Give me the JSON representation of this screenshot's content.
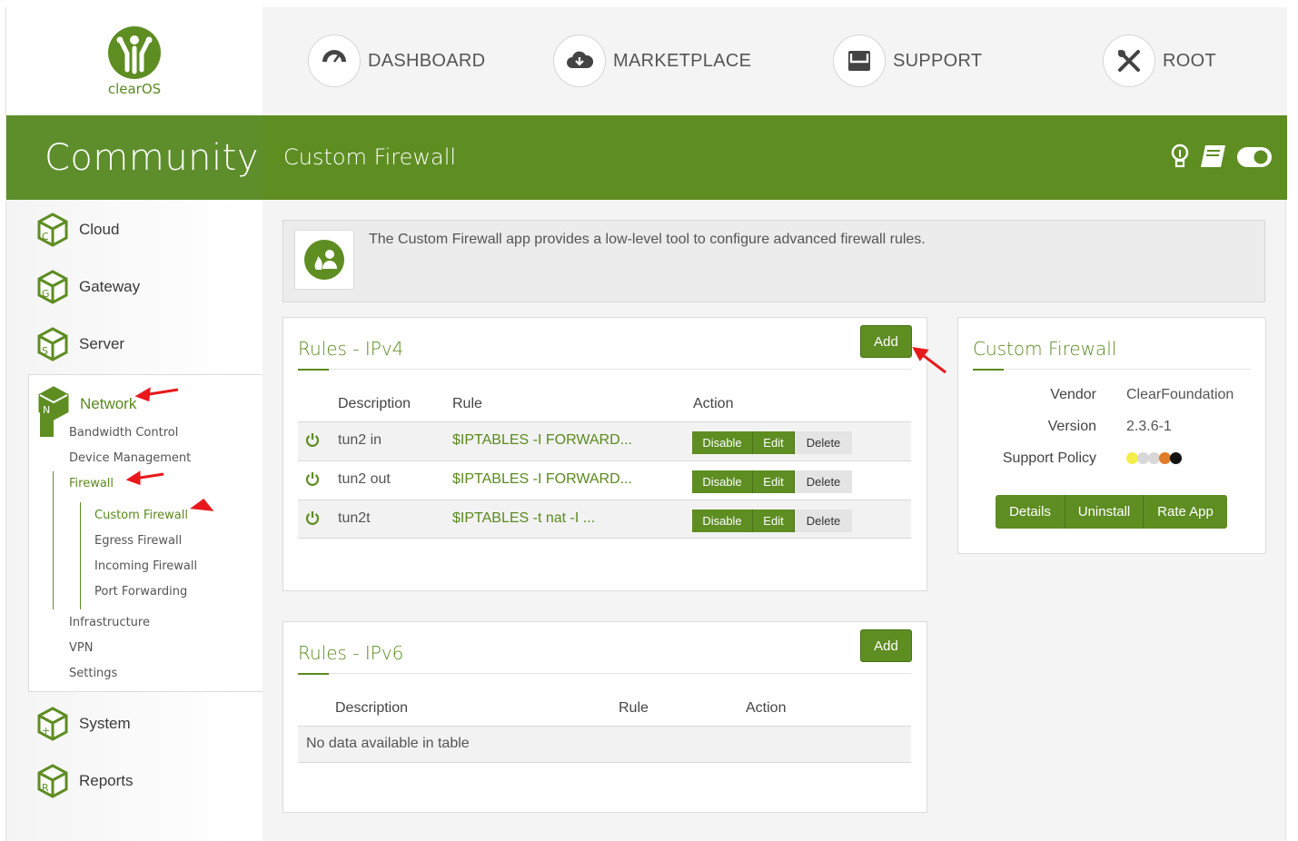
{
  "logo": {
    "text": "clearOS"
  },
  "topnav": [
    {
      "label": "DASHBOARD",
      "icon": "speedometer-icon"
    },
    {
      "label": "MARKETPLACE",
      "icon": "cloud-download-icon"
    },
    {
      "label": "SUPPORT",
      "icon": "inbox-icon"
    },
    {
      "label": "ROOT",
      "icon": "tools-icon"
    }
  ],
  "edition": "Community",
  "app_title": "Custom Firewall",
  "sidebar": {
    "items": [
      {
        "label": "Cloud",
        "letter": "C"
      },
      {
        "label": "Gateway",
        "letter": "G"
      },
      {
        "label": "Server",
        "letter": "S"
      },
      {
        "label": "Network",
        "letter": "N"
      },
      {
        "label": "System",
        "letter": "+"
      },
      {
        "label": "Reports",
        "letter": "R"
      }
    ],
    "network_sub": [
      "Bandwidth Control",
      "Device Management",
      "Firewall",
      "Infrastructure",
      "VPN",
      "Settings"
    ],
    "firewall_sub": [
      "Custom Firewall",
      "Egress Firewall",
      "Incoming Firewall",
      "Port Forwarding"
    ]
  },
  "intro": {
    "text": "The Custom Firewall app provides a low-level tool to configure advanced firewall rules."
  },
  "ipv4": {
    "title": "Rules - IPv4",
    "add_label": "Add",
    "columns": {
      "description": "Description",
      "rule": "Rule",
      "action": "Action"
    },
    "rows": [
      {
        "description": "tun2 in",
        "rule": "$IPTABLES -I FORWARD..."
      },
      {
        "description": "tun2 out",
        "rule": "$IPTABLES -I FORWARD..."
      },
      {
        "description": "tun2t",
        "rule": "$IPTABLES -t nat -I ..."
      }
    ],
    "actions": {
      "disable": "Disable",
      "edit": "Edit",
      "delete": "Delete"
    }
  },
  "ipv6": {
    "title": "Rules - IPv6",
    "add_label": "Add",
    "columns": {
      "description": "Description",
      "rule": "Rule",
      "action": "Action"
    },
    "empty": "No data available in table"
  },
  "info": {
    "title": "Custom Firewall",
    "vendor_label": "Vendor",
    "vendor": "ClearFoundation",
    "version_label": "Version",
    "version": "2.3.6-1",
    "policy_label": "Support Policy",
    "policy_dots": [
      "#f5ee4a",
      "#d8d8d8",
      "#d8d8d8",
      "#e07b27",
      "#111111"
    ],
    "buttons": {
      "details": "Details",
      "uninstall": "Uninstall",
      "rate": "Rate App"
    }
  },
  "colors": {
    "brand_green": "#5e8d22",
    "annotation_red": "#e8191c"
  }
}
